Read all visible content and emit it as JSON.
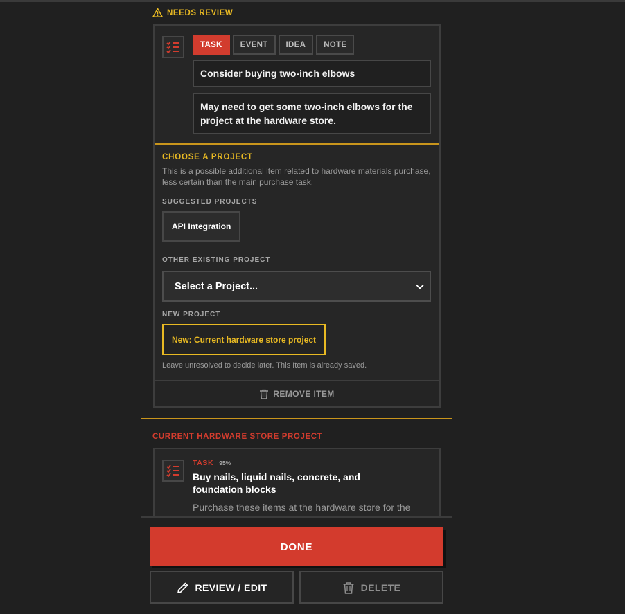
{
  "review_status": "NEEDS REVIEW",
  "item": {
    "tabs": [
      {
        "label": "TASK",
        "active": true
      },
      {
        "label": "EVENT",
        "active": false
      },
      {
        "label": "IDEA",
        "active": false
      },
      {
        "label": "NOTE",
        "active": false
      }
    ],
    "title": "Consider buying two-inch elbows",
    "description": "May need to get some two-inch elbows for the project at the hardware store."
  },
  "choose_project": {
    "heading": "CHOOSE A PROJECT",
    "explanation": "This is a possible additional item related to hardware materials purchase, less certain than the main purchase task.",
    "suggested_heading": "SUGGESTED PROJECTS",
    "suggested": [
      "API Integration"
    ],
    "other_heading": "OTHER EXISTING PROJECT",
    "select_value": "Select a Project...",
    "new_heading": "NEW PROJECT",
    "new_button": "New: Current hardware store project",
    "hint": "Leave unresolved to decide later. This Item is already saved."
  },
  "remove_label": "REMOVE ITEM",
  "project_section": {
    "label": "CURRENT HARDWARE STORE PROJECT",
    "item": {
      "type": "TASK",
      "confidence": "95%",
      "title": "Buy nails, liquid nails, concrete, and foundation blocks",
      "description": "Purchase these items at the hardware store for the current project."
    }
  },
  "actions": {
    "done": "DONE",
    "review_edit": "REVIEW / EDIT",
    "delete": "DELETE"
  },
  "colors": {
    "accent_red": "#d33b2d",
    "accent_gold": "#e8b923",
    "background": "#202020"
  }
}
